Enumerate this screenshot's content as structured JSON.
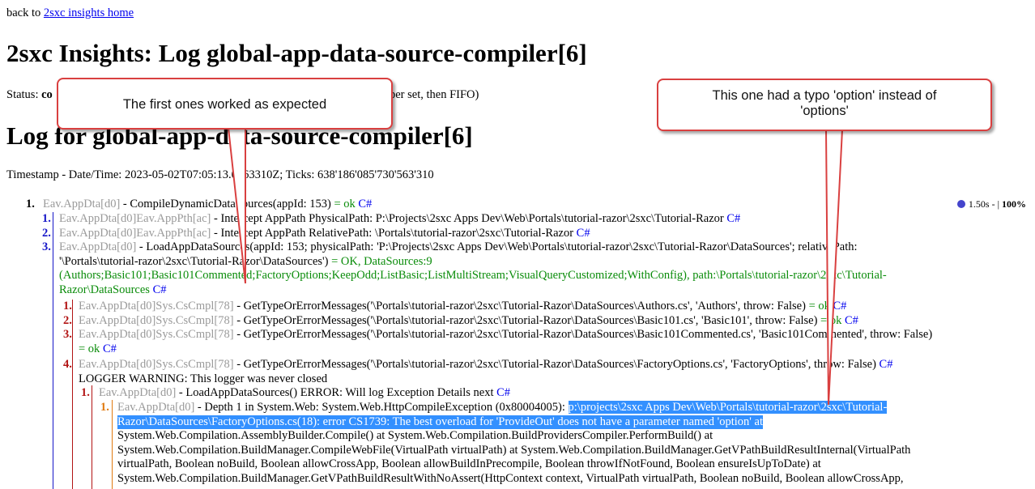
{
  "nav": {
    "back_prefix": "back to ",
    "back_link": "2sxc insights home"
  },
  "title1": "2sxc Insights: Log global-app-data-source-compiler[6]",
  "status": {
    "label": "Status: ",
    "value_start": "co",
    "value_end": "per set, then FIFO)"
  },
  "title2": "Log for global-app-data-source-compiler[6]",
  "timestamp": "Timestamp - Date/Time: 2023-05-02T07:05:13.0563310Z; Ticks: 638'186'085'730'563'310",
  "perf": {
    "time": "1.50s - |",
    "pct": "100%"
  },
  "callouts": {
    "left": "The first ones worked as expected",
    "right": "This one had a typo 'option' instead of 'options'"
  },
  "log": {
    "l1": {
      "num": "1.",
      "src": "Eav.AppDta[d0]",
      "text": " - CompileDynamicDataSources(appId: 153) ",
      "ok": "= ok",
      "cs": "C#"
    },
    "l1_1": {
      "num": "1.",
      "src": "Eav.AppDta[d0]Eav.AppPth[ac]",
      "text": " - Intercept AppPath PhysicalPath: P:\\Projects\\2sxc Apps Dev\\Web\\Portals\\tutorial-razor\\2sxc\\Tutorial-Razor ",
      "cs": "C#"
    },
    "l1_2": {
      "num": "2.",
      "src": "Eav.AppDta[d0]Eav.AppPth[ac]",
      "text": " - Intercept AppPath RelativePath: \\Portals\\tutorial-razor\\2sxc\\Tutorial-Razor ",
      "cs": "C#"
    },
    "l1_3": {
      "num": "3.",
      "src": "Eav.AppDta[d0]",
      "text_a": " - LoadAppDataSources(appId: 153; physicalPath: 'P:\\Projects\\2sxc Apps Dev\\Web\\Portals\\tutorial-razor\\2sxc\\Tutorial-Razor\\DataSources'; relativePath:",
      "text_b": "'\\Portals\\tutorial-razor\\2sxc\\Tutorial-Razor\\DataSources') ",
      "ok_a": "= OK, DataSources:9",
      "ok_b": "(Authors;Basic101;Basic101Commented;FactoryOptions;KeepOdd;ListBasic;ListMultiStream;VisualQueryCustomized;WithConfig), path:\\Portals\\tutorial-razor\\2sxc\\Tutorial-",
      "ok_c": "Razor\\DataSources",
      "cs": "C#"
    },
    "s1": {
      "num": "1.",
      "src": "Eav.AppDta[d0]Sys.CsCmpl[78]",
      "text": " - GetTypeOrErrorMessages('\\Portals\\tutorial-razor\\2sxc\\Tutorial-Razor\\DataSources\\Authors.cs', 'Authors', throw: False) ",
      "ok": "= ok",
      "cs": "C#"
    },
    "s2": {
      "num": "2.",
      "src": "Eav.AppDta[d0]Sys.CsCmpl[78]",
      "text": " - GetTypeOrErrorMessages('\\Portals\\tutorial-razor\\2sxc\\Tutorial-Razor\\DataSources\\Basic101.cs', 'Basic101', throw: False) ",
      "ok": "= ok",
      "cs": "C#"
    },
    "s3": {
      "num": "3.",
      "src": "Eav.AppDta[d0]Sys.CsCmpl[78]",
      "text": " - GetTypeOrErrorMessages('\\Portals\\tutorial-razor\\2sxc\\Tutorial-Razor\\DataSources\\Basic101Commented.cs', 'Basic101Commented', throw: False)",
      "ok": "= ok",
      "cs": "C#"
    },
    "s4": {
      "num": "4.",
      "src": "Eav.AppDta[d0]Sys.CsCmpl[78]",
      "text": " - GetTypeOrErrorMessages('\\Portals\\tutorial-razor\\2sxc\\Tutorial-Razor\\DataSources\\FactoryOptions.cs', 'FactoryOptions', throw: False) ",
      "cs": "C#",
      "warn": "LOGGER WARNING: This logger was never closed"
    },
    "e1": {
      "num": "1.",
      "src": "Eav.AppDta[d0]",
      "text": " - LoadAppDataSources() ERROR: Will log Exception Details next ",
      "cs": "C#"
    },
    "e1_1": {
      "num": "1.",
      "src": "Eav.AppDta[d0]",
      "text": " - Depth 1 in System.Web: System.Web.HttpCompileException (0x80004005): ",
      "sel_a": "p:\\projects\\2sxc Apps Dev\\Web\\Portals\\tutorial-razor\\2sxc\\Tutorial-",
      "sel_b": "Razor\\DataSources\\FactoryOptions.cs(18): error CS1739: The best overload for 'ProvideOut' does not have a parameter named 'option' at",
      "trace1": "System.Web.Compilation.AssemblyBuilder.Compile() at System.Web.Compilation.BuildProvidersCompiler.PerformBuild() at",
      "trace2": "System.Web.Compilation.BuildManager.CompileWebFile(VirtualPath virtualPath) at System.Web.Compilation.BuildManager.GetVPathBuildResultInternal(VirtualPath",
      "trace3": "virtualPath, Boolean noBuild, Boolean allowCrossApp, Boolean allowBuildInPrecompile, Boolean throwIfNotFound, Boolean ensureIsUpToDate) at",
      "trace4": "System.Web.Compilation.BuildManager.GetVPathBuildResultWithNoAssert(HttpContext context, VirtualPath virtualPath, Boolean noBuild, Boolean allowCrossApp,"
    }
  }
}
